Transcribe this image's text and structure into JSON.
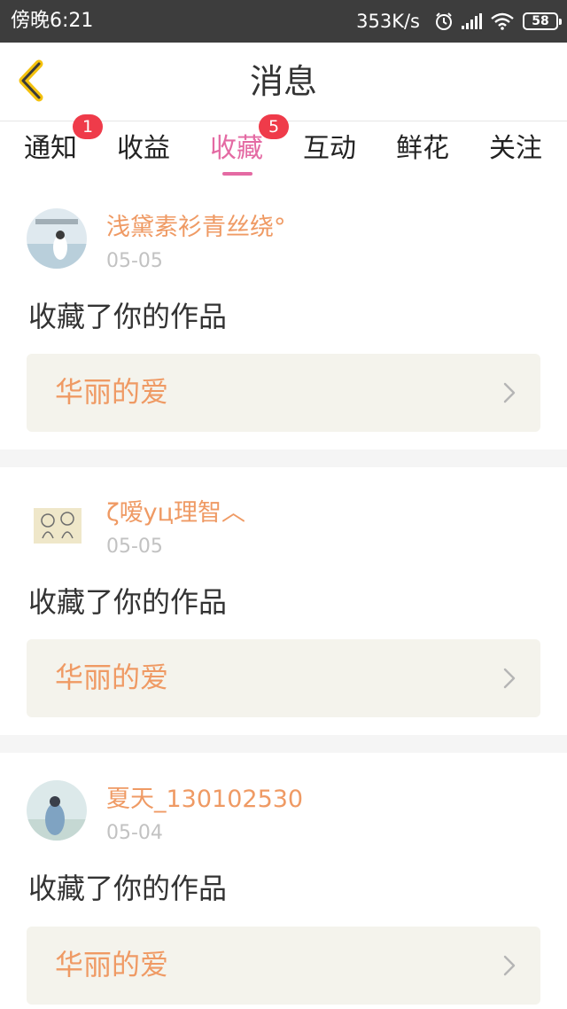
{
  "status_bar": {
    "time": "傍晚6:21",
    "net_speed": "353K/s",
    "icons": [
      "alarm-icon",
      "signal-icon",
      "wifi-icon"
    ],
    "battery": "58"
  },
  "header": {
    "back_icon": "chevron-left-icon",
    "title": "消息",
    "accent_color": "#f4c10d"
  },
  "tabs": [
    {
      "label": "通知",
      "badge": "1"
    },
    {
      "label": "收益"
    },
    {
      "label": "收藏",
      "badge": "5",
      "active": true
    },
    {
      "label": "互动"
    },
    {
      "label": "鲜花"
    },
    {
      "label": "关注"
    }
  ],
  "colors": {
    "active_tab": "#e46aa3",
    "badge": "#ef3b4a",
    "username": "#ef9a64",
    "work_bg": "#f4f3ec"
  },
  "items": [
    {
      "username": "浅黛素衫青丝绕°",
      "date": "05-05",
      "message": "收藏了你的作品",
      "work_title": "华丽的爱"
    },
    {
      "username": "ζ嗳yц理智︿",
      "date": "05-05",
      "message": "收藏了你的作品",
      "work_title": "华丽的爱"
    },
    {
      "username": "夏天_130102530",
      "date": "05-04",
      "message": "收藏了你的作品",
      "work_title": "华丽的爱"
    }
  ]
}
